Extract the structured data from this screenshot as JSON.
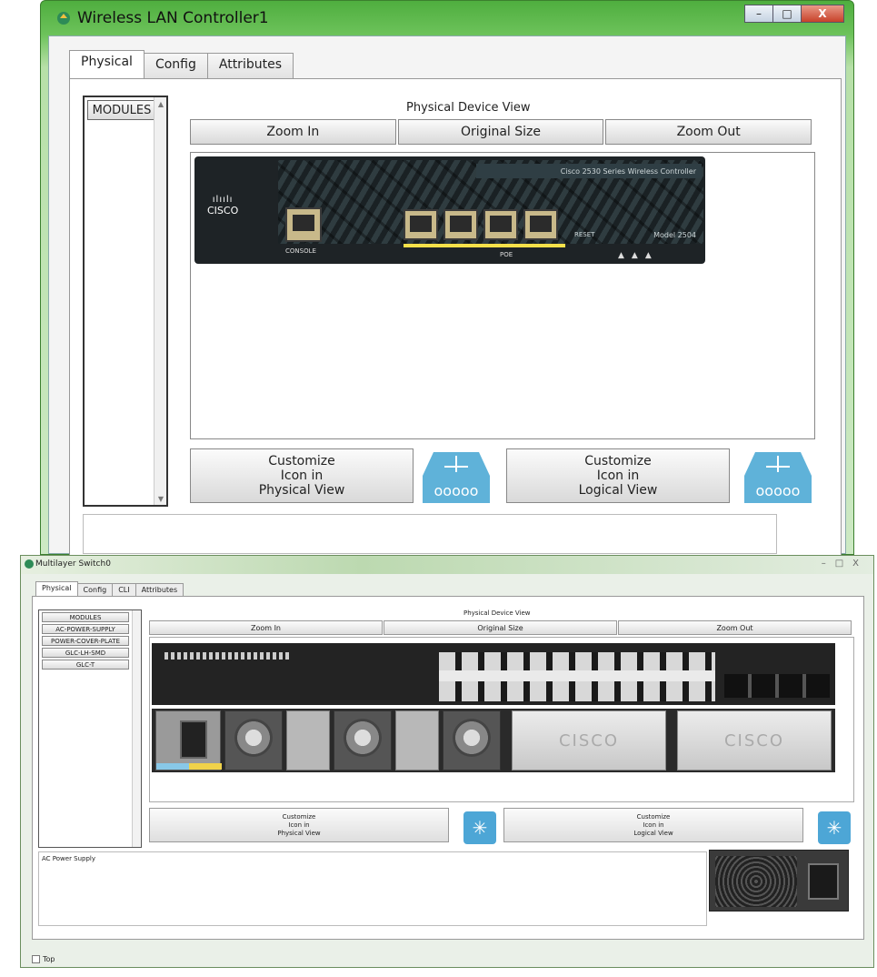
{
  "window1": {
    "title": "Wireless LAN Controller1",
    "tabs": [
      {
        "label": "Physical"
      },
      {
        "label": "Config"
      },
      {
        "label": "Attributes"
      }
    ],
    "modules_button": "MODULES",
    "physical_view_title": "Physical Device View",
    "zoom": {
      "in": "Zoom In",
      "original": "Original Size",
      "out": "Zoom Out"
    },
    "device": {
      "model_strip": "Cisco 2530 Series Wireless Controller",
      "model_label": "Model 2504",
      "console_label": "CONSOLE",
      "poe_label": "POE",
      "reset_label": "RESET",
      "logo_bars": "ılıılı",
      "logo_text": "CISCO"
    },
    "customize_physical": [
      "Customize",
      "Icon in",
      "Physical View"
    ],
    "customize_logical": [
      "Customize",
      "Icon in",
      "Logical View"
    ],
    "window_buttons": {
      "minimize": "–",
      "maximize": "□",
      "close": "X"
    }
  },
  "window2": {
    "title": "Multilayer Switch0",
    "tabs": [
      {
        "label": "Physical"
      },
      {
        "label": "Config"
      },
      {
        "label": "CLI"
      },
      {
        "label": "Attributes"
      }
    ],
    "modules": [
      "MODULES",
      "AC-POWER-SUPPLY",
      "POWER-COVER-PLATE",
      "GLC-LH-SMD",
      "GLC-T"
    ],
    "physical_view_title": "Physical Device View",
    "zoom": {
      "in": "Zoom In",
      "original": "Original Size",
      "out": "Zoom Out"
    },
    "customize_physical": [
      "Customize",
      "Icon in",
      "Physical View"
    ],
    "customize_logical": [
      "Customize",
      "Icon in",
      "Logical View"
    ],
    "info_text": "AC Power Supply",
    "footer_checkbox_label": "Top",
    "cisco_plate_text": "CISCO"
  }
}
